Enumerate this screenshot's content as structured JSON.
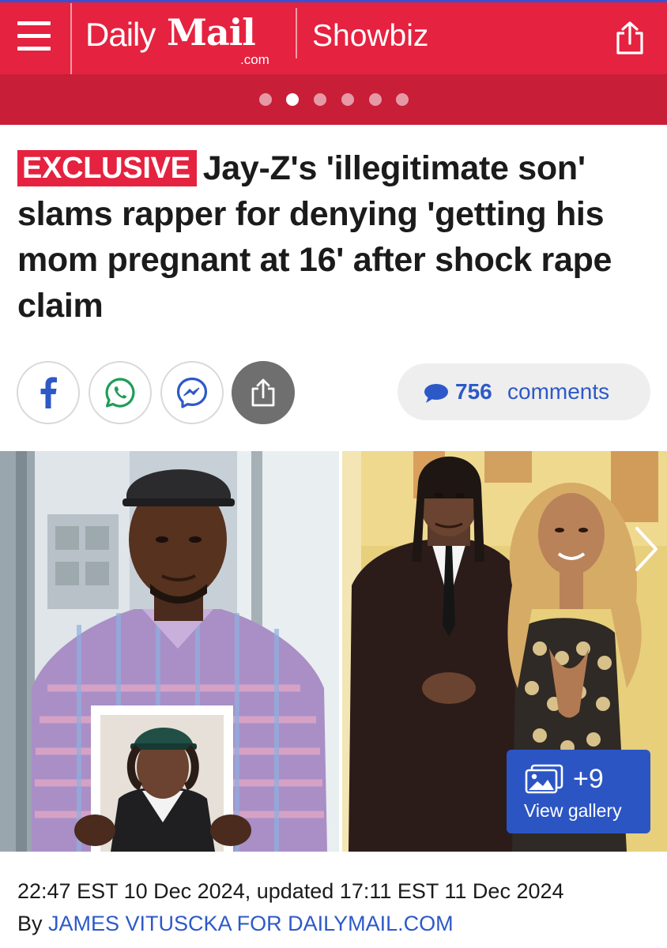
{
  "header": {
    "logo_daily": "Daily",
    "logo_mail": "Mail",
    "logo_com": ".com",
    "section": "Showbiz",
    "brand_color": "#e5223f",
    "icons": {
      "menu": "hamburger-icon",
      "share": "share-icon"
    }
  },
  "carousel": {
    "total": 6,
    "active_index": 1
  },
  "article": {
    "badge": "EXCLUSIVE",
    "headline": "Jay-Z's 'illegitimate son' slams rapper for denying 'getting his mom pregnant at 16' after shock rape claim"
  },
  "share": {
    "buttons": [
      "facebook-icon",
      "whatsapp-icon",
      "messenger-icon",
      "share-icon"
    ],
    "comments_count": "756",
    "comments_label": "comments",
    "accent": "#2d59c8"
  },
  "gallery": {
    "plus": "+9",
    "label": "View gallery",
    "button_color": "#2c55c4"
  },
  "meta": {
    "date": "22:47 EST 10 Dec 2024, updated 17:11 EST 11 Dec 2024",
    "by_prefix": "By",
    "author": "JAMES VITUSCKA FOR DAILYMAIL.COM"
  }
}
